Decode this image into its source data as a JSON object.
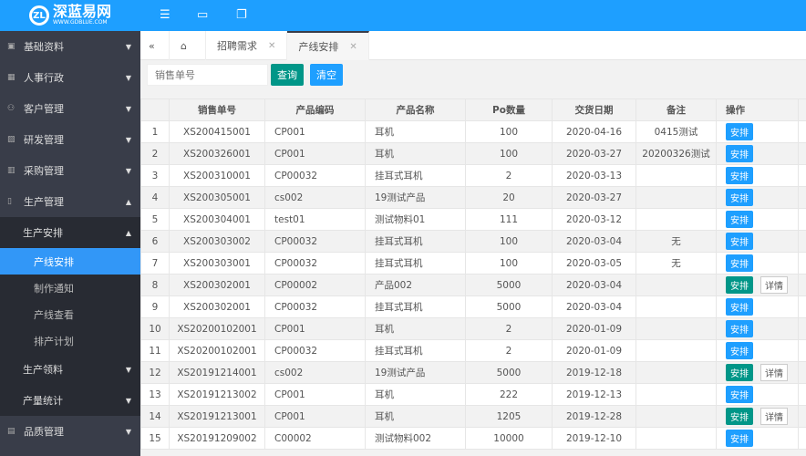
{
  "header": {
    "logo_cn": "深蓝易网",
    "logo_en": "WWW.GDBLUE.COM",
    "brand_color": "#1E9FFF"
  },
  "sidebar": {
    "items": [
      {
        "label": "基础资料",
        "icon": "book-icon"
      },
      {
        "label": "人事行政",
        "icon": "grid-icon"
      },
      {
        "label": "客户管理",
        "icon": "users-icon"
      },
      {
        "label": "研发管理",
        "icon": "flask-icon"
      },
      {
        "label": "采购管理",
        "icon": "cart-icon"
      },
      {
        "label": "生产管理",
        "icon": "file-icon"
      }
    ],
    "production": {
      "group": "生产安排",
      "children": [
        "产线安排",
        "制作通知",
        "产线查看",
        "排产计划"
      ],
      "others": [
        "生产领料",
        "产量统计"
      ]
    },
    "after": {
      "label": "品质管理",
      "icon": "clipboard-icon"
    }
  },
  "tabs": [
    {
      "label": "招聘需求"
    },
    {
      "label": "产线安排",
      "active": true
    }
  ],
  "toolbar": {
    "placeholder": "销售单号",
    "query": "查询",
    "clear": "清空"
  },
  "table": {
    "columns": [
      "",
      "销售单号",
      "产品编码",
      "产品名称",
      "Po数量",
      "交货日期",
      "备注",
      "操作"
    ],
    "arrange": "安排",
    "detail": "详情",
    "rows": [
      [
        "1",
        "XS200415001",
        "CP001",
        "耳机",
        "100",
        "2020-04-16",
        "0415测试",
        false
      ],
      [
        "2",
        "XS200326001",
        "CP001",
        "耳机",
        "100",
        "2020-03-27",
        "20200326测试",
        false
      ],
      [
        "3",
        "XS200310001",
        "CP00032",
        "挂耳式耳机",
        "2",
        "2020-03-13",
        "",
        false
      ],
      [
        "4",
        "XS200305001",
        "cs002",
        "19测试产品",
        "20",
        "2020-03-27",
        "",
        false
      ],
      [
        "5",
        "XS200304001",
        "test01",
        "测试物料01",
        "111",
        "2020-03-12",
        "",
        false
      ],
      [
        "6",
        "XS200303002",
        "CP00032",
        "挂耳式耳机",
        "100",
        "2020-03-04",
        "无",
        false
      ],
      [
        "7",
        "XS200303001",
        "CP00032",
        "挂耳式耳机",
        "100",
        "2020-03-05",
        "无",
        false
      ],
      [
        "8",
        "XS200302001",
        "CP00002",
        "产品002",
        "5000",
        "2020-03-04",
        "",
        true
      ],
      [
        "9",
        "XS200302001",
        "CP00032",
        "挂耳式耳机",
        "5000",
        "2020-03-04",
        "",
        false
      ],
      [
        "10",
        "XS20200102001",
        "CP001",
        "耳机",
        "2",
        "2020-01-09",
        "",
        false
      ],
      [
        "11",
        "XS20200102001",
        "CP00032",
        "挂耳式耳机",
        "2",
        "2020-01-09",
        "",
        false
      ],
      [
        "12",
        "XS20191214001",
        "cs002",
        "19测试产品",
        "5000",
        "2019-12-18",
        "",
        true
      ],
      [
        "13",
        "XS20191213002",
        "CP001",
        "耳机",
        "222",
        "2019-12-13",
        "",
        false
      ],
      [
        "14",
        "XS20191213001",
        "CP001",
        "耳机",
        "1205",
        "2019-12-28",
        "",
        true
      ],
      [
        "15",
        "XS20191209002",
        "C00002",
        "测试物料002",
        "10000",
        "2019-12-10",
        "",
        false
      ]
    ]
  }
}
